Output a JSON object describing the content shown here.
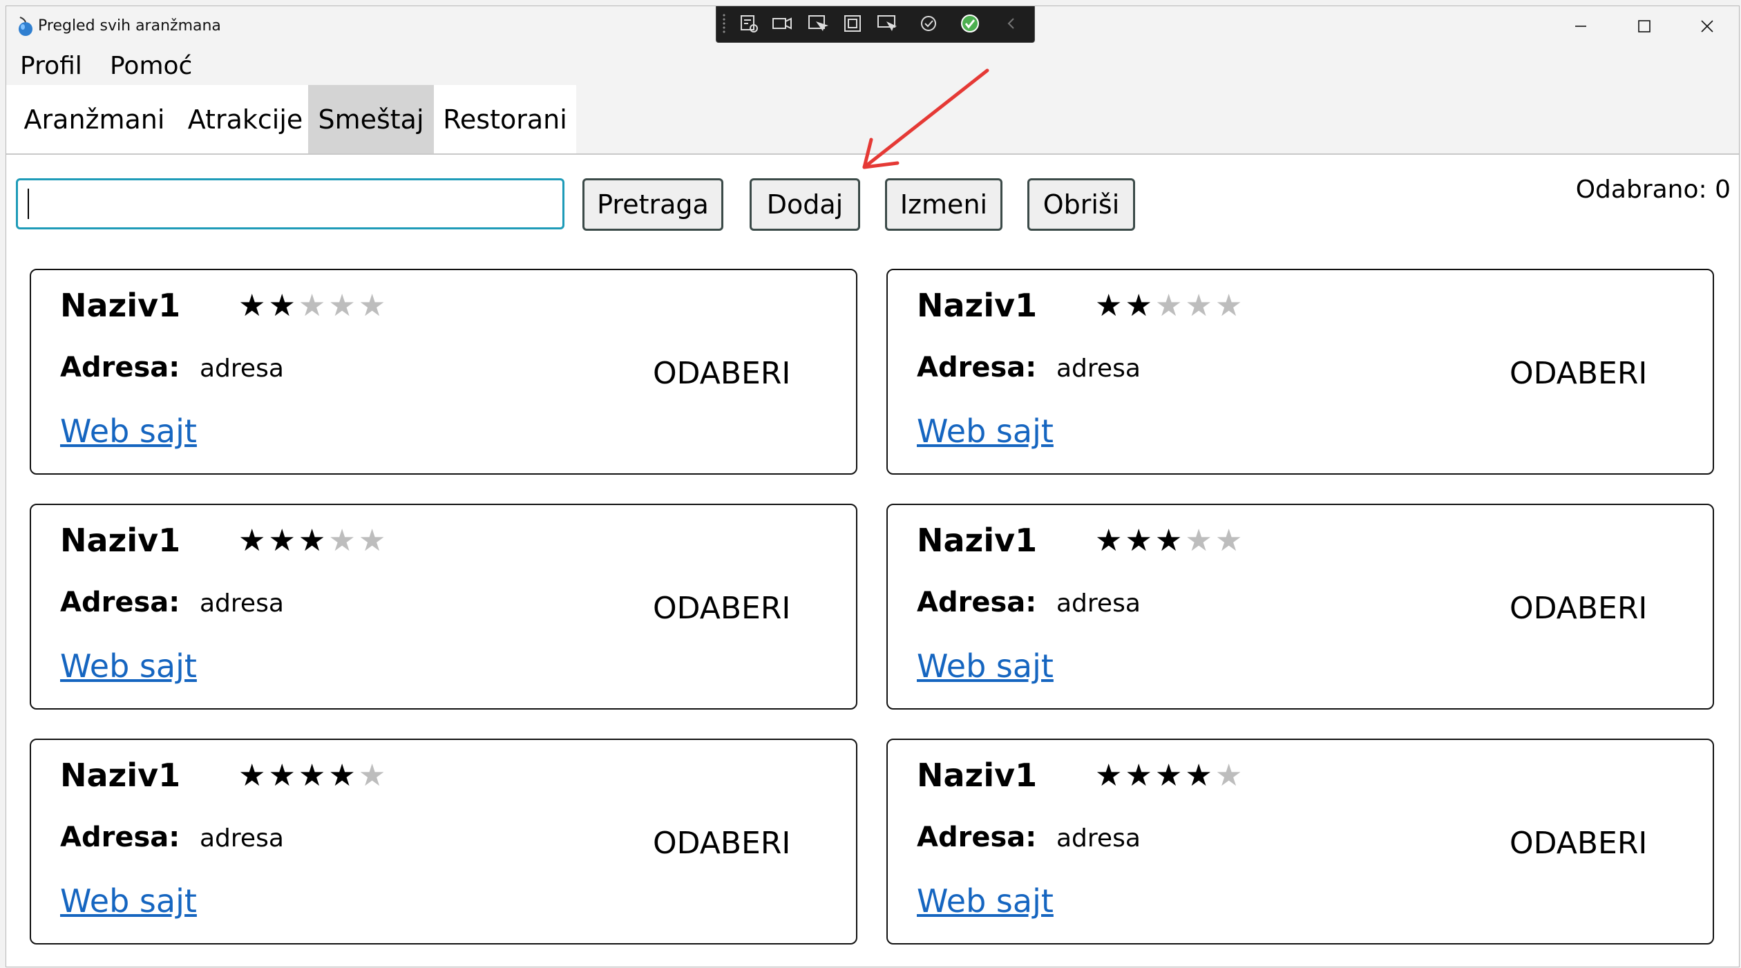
{
  "window": {
    "title": "Pregled svih aranžmana"
  },
  "menu": [
    {
      "label": "Profil"
    },
    {
      "label": "Pomoć"
    }
  ],
  "tabs": [
    {
      "label": "Aranžmani",
      "active": false
    },
    {
      "label": "Atrakcije",
      "active": false
    },
    {
      "label": "Smeštaj",
      "active": true
    },
    {
      "label": "Restorani",
      "active": false
    }
  ],
  "toolbar": {
    "search_value": "",
    "search_label": "Pretraga",
    "add_label": "Dodaj",
    "edit_label": "Izmeni",
    "delete_label": "Obriši",
    "selected_text": "Odabrano: 0"
  },
  "cards": [
    {
      "name": "Naziv1",
      "rating": 2,
      "address_label": "Adresa:",
      "address": "adresa",
      "select_label": "ODABERI",
      "web_label": "Web sajt"
    },
    {
      "name": "Naziv1",
      "rating": 3,
      "address_label": "Adresa:",
      "address": "adresa",
      "select_label": "ODABERI",
      "web_label": "Web sajt"
    },
    {
      "name": "Naziv1",
      "rating": 4,
      "address_label": "Adresa:",
      "address": "adresa",
      "select_label": "ODABERI",
      "web_label": "Web sajt"
    },
    {
      "name": "Naziv1",
      "rating": 2,
      "address_label": "Adresa:",
      "address": "adresa",
      "select_label": "ODABERI",
      "web_label": "Web sajt"
    },
    {
      "name": "Naziv1",
      "rating": 3,
      "address_label": "Adresa:",
      "address": "adresa",
      "select_label": "ODABERI",
      "web_label": "Web sajt"
    },
    {
      "name": "Naziv1",
      "rating": 4,
      "address_label": "Adresa:",
      "address": "adresa",
      "select_label": "ODABERI",
      "web_label": "Web sajt"
    }
  ],
  "rating_max": 5,
  "colors": {
    "link": "#1565c0",
    "search_border": "#1e9bb8",
    "active_tab": "#d4d4d4",
    "annotation_arrow": "#e53935"
  }
}
